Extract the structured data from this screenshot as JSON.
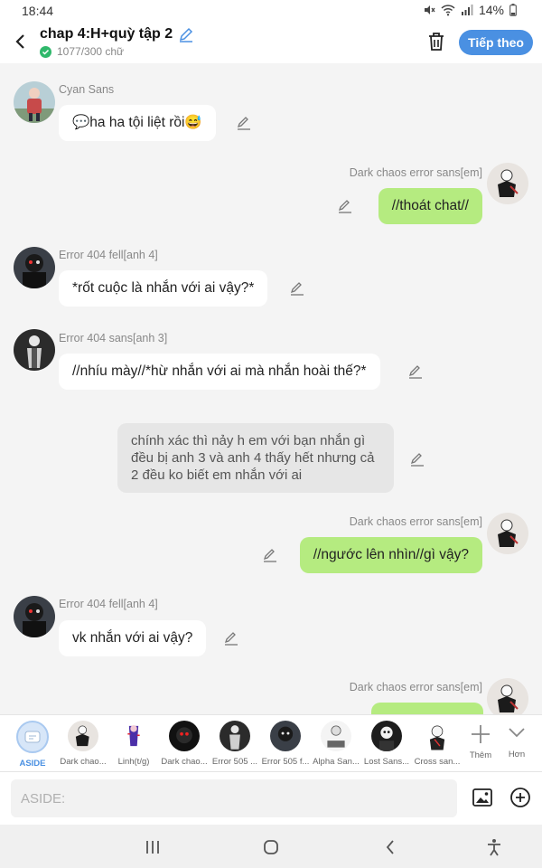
{
  "status_bar": {
    "time": "18:44",
    "battery": "14%"
  },
  "header": {
    "title": "chap 4:H+quỳ tập 2",
    "word_count": "1077/300 chữ",
    "next_label": "Tiếp theo"
  },
  "messages": [
    {
      "sender": "Cyan Sans",
      "text": "💬ha ha tội liệt rồi😅",
      "side": "left"
    },
    {
      "sender": "Dark chaos error sans[em]",
      "text": "//thoát chat//",
      "side": "right"
    },
    {
      "sender": "Error 404 fell[anh 4]",
      "text": "*rốt cuộc là nhắn với ai vậy?*",
      "side": "left"
    },
    {
      "sender": "Error 404 sans[anh 3]",
      "text": "//nhíu mày//*hừ nhắn với ai mà nhắn hoài thế?*",
      "side": "left"
    },
    {
      "sender": "",
      "text": "chính xác thì nảy h em với bạn nhắn gì đều bị anh 3 và anh 4 thấy hết nhưng cả 2 đều ko biết em nhắn với ai",
      "side": "aside"
    },
    {
      "sender": "Dark chaos error sans[em]",
      "text": "//ngước lên nhìn//gì vậy?",
      "side": "right"
    },
    {
      "sender": "Error 404 fell[anh 4]",
      "text": "vk nhắn với ai vậy?",
      "side": "left"
    },
    {
      "sender": "Dark chaos error sans[em]",
      "text": "",
      "side": "right"
    }
  ],
  "characters": [
    {
      "name": "ASIDE"
    },
    {
      "name": "Dark chao..."
    },
    {
      "name": "Linh(t/g)"
    },
    {
      "name": "Dark chao..."
    },
    {
      "name": "Error 505 ..."
    },
    {
      "name": "Error 505 f..."
    },
    {
      "name": "Alpha San..."
    },
    {
      "name": "Lost Sans..."
    },
    {
      "name": "Cross san..."
    }
  ],
  "char_actions": {
    "add_label": "Thêm",
    "more_label": "Hơn"
  },
  "input": {
    "placeholder": "ASIDE:"
  },
  "colors": {
    "accent": "#4a90e2",
    "right_bubble": "#b5eb80",
    "aside_bubble": "#e6e6e6",
    "check": "#2fb86b"
  }
}
